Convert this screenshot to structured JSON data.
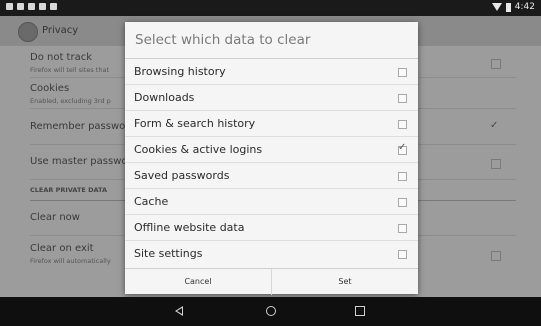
{
  "statusbar": {
    "time": "4:42"
  },
  "background": {
    "header_title": "Privacy",
    "rows": [
      {
        "title": "Do not track",
        "sub": "Firefox will tell sites that"
      },
      {
        "title": "Cookies",
        "sub": "Enabled, excluding 3rd p"
      },
      {
        "title": "Remember passwo"
      },
      {
        "title": "Use master passwo"
      },
      {
        "title": "Clear now"
      },
      {
        "title": "Clear on exit",
        "sub": "Firefox will automatically"
      }
    ],
    "section": "CLEAR PRIVATE DATA"
  },
  "dialog": {
    "title": "Select which data to clear",
    "options": [
      {
        "label": "Browsing history",
        "checked": false
      },
      {
        "label": "Downloads",
        "checked": false
      },
      {
        "label": "Form & search history",
        "checked": false
      },
      {
        "label": "Cookies & active logins",
        "checked": true
      },
      {
        "label": "Saved passwords",
        "checked": false
      },
      {
        "label": "Cache",
        "checked": false
      },
      {
        "label": "Offline website data",
        "checked": false
      },
      {
        "label": "Site settings",
        "checked": false
      }
    ],
    "cancel_label": "Cancel",
    "set_label": "Set"
  },
  "icons": {
    "checkmark": "✓"
  }
}
